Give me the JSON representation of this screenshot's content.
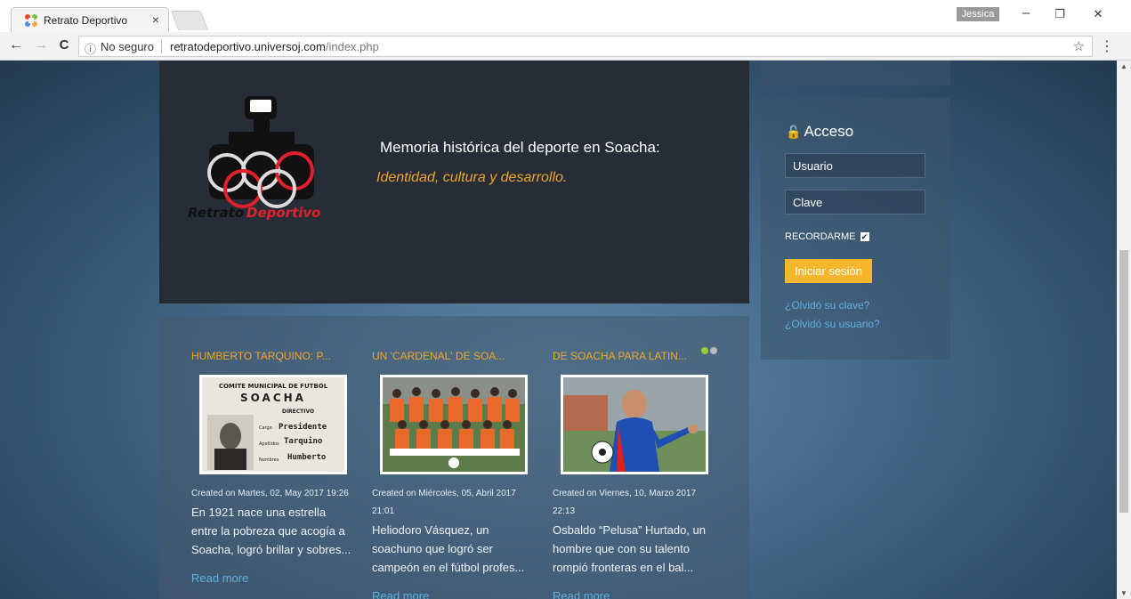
{
  "browser": {
    "tab_title": "Retrato Deportivo",
    "tab_close": "×",
    "profile_name": "Jessica",
    "security_label": "No seguro",
    "url_host": "retratodeportivo.universoj.com",
    "url_path": "/index.php",
    "controls": {
      "minimize": "–",
      "restore": "❐",
      "close": "✕",
      "back": "←",
      "forward": "→",
      "reload": "C",
      "info": "ⓘ",
      "star": "☆",
      "menu": "⋮"
    }
  },
  "hero": {
    "logo_text_a": "Retrato",
    "logo_text_b": "Deportivo",
    "title": "Memoria histórica del deporte en Soacha:",
    "subtitle": "Identidad, cultura y desarrollo."
  },
  "articles": [
    {
      "title": "HUMBERTO TARQUINO: P...",
      "date": "Created on Martes, 02, May 2017 19:26",
      "intro": "En 1921 nace una estrella entre la pobreza que acogía a Soacha, logró brillar y sobres...",
      "more": "Read more",
      "card_lines": [
        "COMITE MUNICIPAL DE FUTBOL",
        "SOACHA",
        "DIRECTIVO",
        "Cargo",
        "Presidente",
        "Apellidos",
        "Tarquino",
        "Nombres",
        "Humberto"
      ]
    },
    {
      "title": "UN 'CARDENAL' DE SOA...",
      "date": "Created on Miércoles, 05, Abril 2017 21:01",
      "intro": "Heliodoro Vásquez, un soachuno que logró ser campeón en el fútbol profes...",
      "more": "Read more"
    },
    {
      "title": "DE SOACHA PARA LATIN...",
      "date": "Created on Viernes, 10, Marzo 2017 22:13",
      "intro": "Osbaldo “Pelusa” Hurtado, un hombre que con su talento rompió fronteras en el bal...",
      "more": "Read more"
    }
  ],
  "login": {
    "title": "Acceso",
    "username_placeholder": "Usuario",
    "password_placeholder": "Clave",
    "remember_label": "RECORDARME",
    "checkbox_mark": "✔",
    "submit_label": "Iniciar sesión",
    "forgot_password": "¿Olvidó su clave?",
    "forgot_username": "¿Olvidó su usuario?"
  },
  "colors": {
    "accent": "#f0a52a",
    "link": "#5fb0e0",
    "button": "#f6b62c",
    "dot_active": "#9acd32"
  }
}
